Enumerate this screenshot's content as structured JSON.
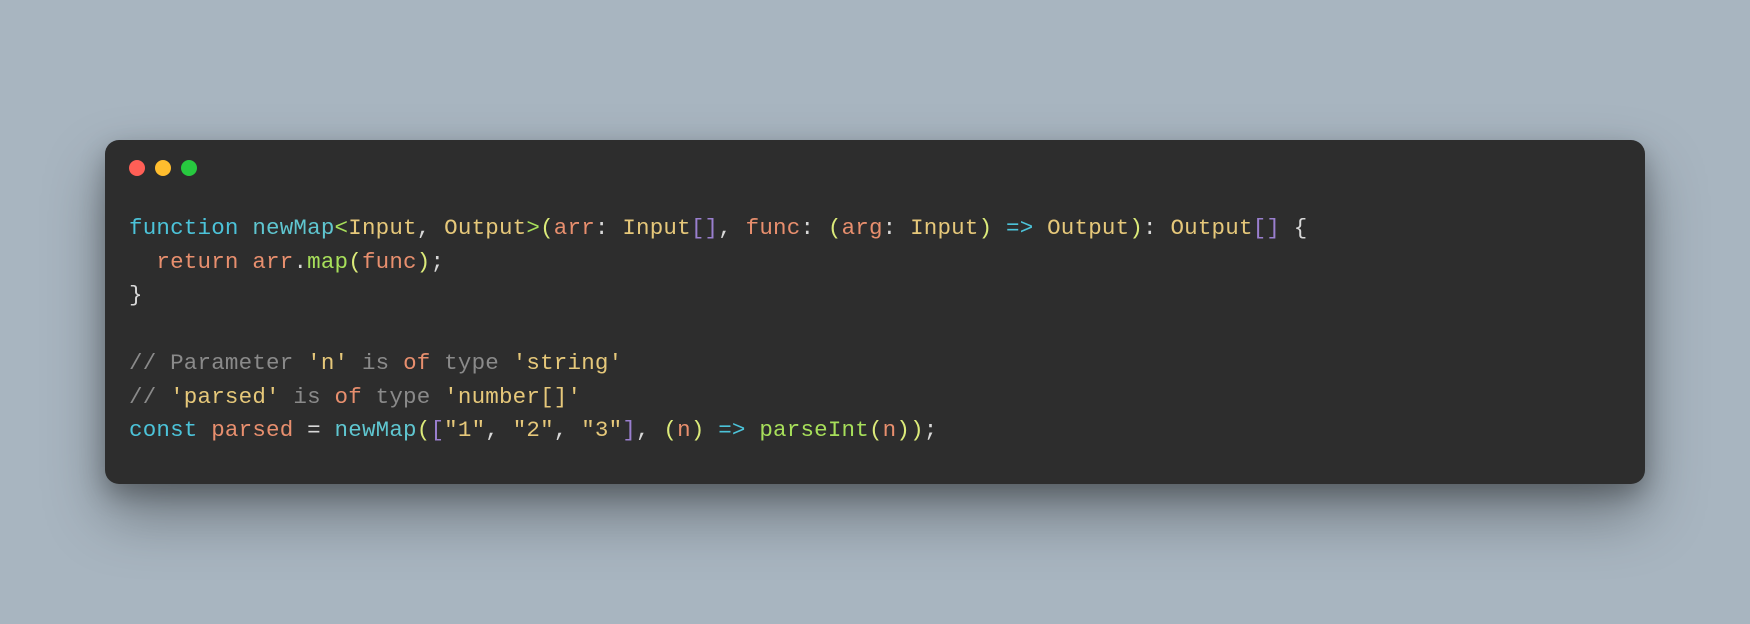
{
  "window": {
    "controls": [
      "close",
      "minimize",
      "zoom"
    ]
  },
  "code": {
    "line1": {
      "kw_function": "function",
      "fn_name": "newMap",
      "lt": "<",
      "type_input": "Input",
      "comma1": ", ",
      "type_output": "Output",
      "gt": ">",
      "lp": "(",
      "arg_arr": "arr",
      "colon1": ": ",
      "type_input2": "Input",
      "brackets1": "[]",
      "comma2": ", ",
      "arg_func": "func",
      "colon2": ": ",
      "lp2": "(",
      "arg_arg": "arg",
      "colon3": ": ",
      "type_input3": "Input",
      "rp2": ")",
      "arrow": " => ",
      "type_output2": "Output",
      "rp": ")",
      "colon4": ": ",
      "type_output3": "Output",
      "brackets2": "[]",
      "sp_cb": " {",
      "cb_open": "{"
    },
    "line2": {
      "indent": "  ",
      "kw_return": "return",
      "sp": " ",
      "id_arr": "arr",
      "dot": ".",
      "call_map": "map",
      "lp": "(",
      "id_func": "func",
      "rp": ")",
      "semi": ";"
    },
    "line3": {
      "cb_close": "}"
    },
    "line5": {
      "slashes": "// ",
      "t1": "Parameter ",
      "lit1": "'n'",
      "t2": " is ",
      "kw_of": "of",
      "t3": " type ",
      "lit2": "'string'"
    },
    "line6": {
      "slashes": "// ",
      "lit1": "'parsed'",
      "t1": " is ",
      "kw_of": "of",
      "t2": " type ",
      "lit2": "'number[]'"
    },
    "line7": {
      "kw_const": "const",
      "sp1": " ",
      "id_parsed": "parsed",
      "sp2": " ",
      "eq": "=",
      "sp3": " ",
      "fn_newMap": "newMap",
      "lp": "(",
      "lb": "[",
      "s1": "\"1\"",
      "c1": ", ",
      "s2": "\"2\"",
      "c2": ", ",
      "s3": "\"3\"",
      "rb": "]",
      "c3": ", ",
      "lp2": "(",
      "id_n": "n",
      "rp2": ")",
      "arrow": " => ",
      "call_parseInt": "parseInt",
      "lp3": "(",
      "id_n2": "n",
      "rp3": ")",
      "rp": ")",
      "semi": ";"
    }
  }
}
